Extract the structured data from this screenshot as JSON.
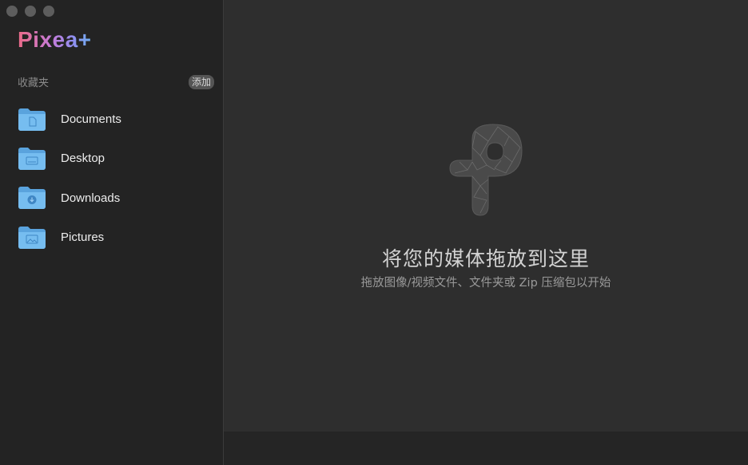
{
  "window": {
    "traffic_lights": [
      "close",
      "minimize",
      "zoom"
    ]
  },
  "sidebar": {
    "logo": "Pixea+",
    "favorites_title": "收藏夹",
    "add_label": "添加",
    "items": [
      {
        "label": "Documents",
        "icon": "documents-folder-icon"
      },
      {
        "label": "Desktop",
        "icon": "desktop-folder-icon"
      },
      {
        "label": "Downloads",
        "icon": "downloads-folder-icon"
      },
      {
        "label": "Pictures",
        "icon": "pictures-folder-icon"
      }
    ]
  },
  "main": {
    "drop_title": "将您的媒体拖放到这里",
    "drop_subtitle": "拖放图像/视频文件、文件夹或 Zip 压缩包以开始",
    "drop_icon": "pixea-logo-icon"
  },
  "colors": {
    "sidebar_bg": "#232323",
    "main_bg": "#2e2e2e",
    "folder_blue": "#6fb6ea"
  }
}
